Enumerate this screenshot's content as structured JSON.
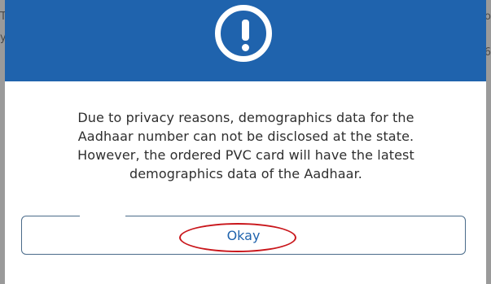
{
  "background": {
    "left_fragments": [
      "To",
      "y"
    ],
    "right_fragments": [
      "Do",
      "6"
    ]
  },
  "dialog": {
    "header_color": "#1f63ad",
    "icon": "exclamation-circle-icon",
    "message_lines": [
      "Due to privacy reasons, demographics data for the",
      "Aadhaar number can not be disclosed at the state.",
      "However, the ordered PVC card will have the latest",
      "demographics data of the Aadhaar."
    ],
    "button_label": "Okay",
    "highlight_color": "#c9161b"
  }
}
